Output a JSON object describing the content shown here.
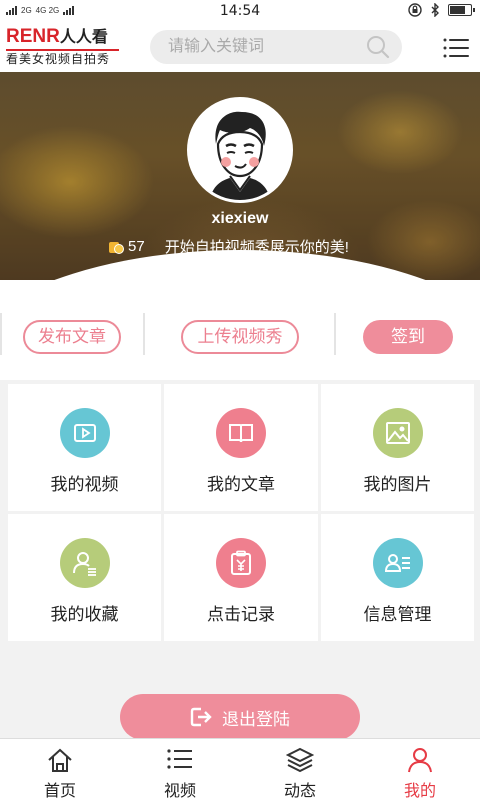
{
  "status_bar": {
    "network_left": "2G",
    "network_right": "4G 2G",
    "time": "14:54"
  },
  "header": {
    "logo_brand": "RENR",
    "logo_brand_cn": "人人看",
    "logo_tagline": "看美女视频自拍秀",
    "search_placeholder": "请输入关键词"
  },
  "profile": {
    "username": "xiexiew",
    "coins": "57",
    "motto": "开始自拍视频秀展示你的美!"
  },
  "actions": {
    "publish_article": "发布文章",
    "upload_video": "上传视频秀",
    "check_in": "签到"
  },
  "grid": [
    {
      "label": "我的视频",
      "icon": "video-icon",
      "color": "#66c6d4"
    },
    {
      "label": "我的文章",
      "icon": "book-icon",
      "color": "#ef7f8e"
    },
    {
      "label": "我的图片",
      "icon": "image-icon",
      "color": "#b6cc7a"
    },
    {
      "label": "我的收藏",
      "icon": "user-list-icon",
      "color": "#b6cc7a"
    },
    {
      "label": "点击记录",
      "icon": "clipboard-yen-icon",
      "color": "#ef7f8e"
    },
    {
      "label": "信息管理",
      "icon": "contact-card-icon",
      "color": "#66c6d4"
    }
  ],
  "logout_label": "退出登陆",
  "tabs": [
    {
      "label": "首页",
      "icon": "home-icon"
    },
    {
      "label": "视频",
      "icon": "list-icon"
    },
    {
      "label": "动态",
      "icon": "layers-icon"
    },
    {
      "label": "我的",
      "icon": "person-icon",
      "active": true
    }
  ],
  "colors": {
    "accent_pink": "#ef8d9b",
    "active_tab": "#e63b45",
    "brand_red": "#d8242a"
  }
}
